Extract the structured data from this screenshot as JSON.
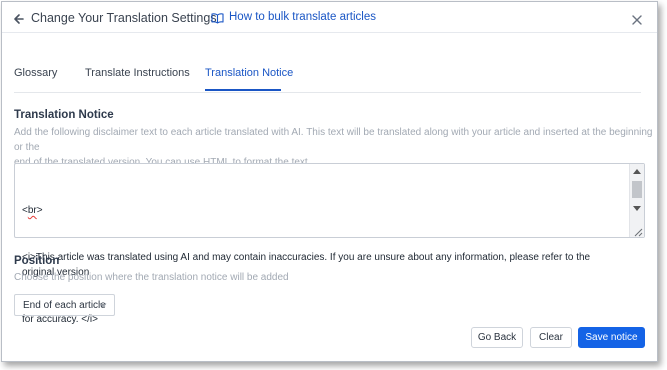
{
  "header": {
    "title": "Change Your Translation Settings",
    "help_link": "How to bulk translate articles"
  },
  "tabs": [
    {
      "label": "Glossary"
    },
    {
      "label": "Translate Instructions"
    },
    {
      "label": "Translation Notice"
    }
  ],
  "notice": {
    "title": "Translation Notice",
    "description_line1": "Add the following disclaimer text to each article translated with AI. This text will be translated along with your article and inserted at the beginning or the",
    "description_line2": "end of the translated version. You can use HTML to format the text.",
    "text_line1_prefix": "<",
    "text_line1_word": "br",
    "text_line1_suffix": ">",
    "text_line2": "<i>This article was translated using AI and may contain inaccuracies. If you are unsure about any information, please refer to the original version",
    "text_line3": "for accuracy. </i>"
  },
  "position": {
    "title": "Position",
    "description": "Choose the position where the translation notice will be added",
    "selected": "End of each article"
  },
  "footer": {
    "go_back": "Go Back",
    "clear": "Clear",
    "save": "Save notice"
  },
  "colors": {
    "accent": "#1a56c5",
    "primary_button": "#1463e6"
  },
  "icons": {
    "back": "arrow-left-icon",
    "help": "book-open-icon",
    "close": "close-icon",
    "select": "chevron-down-icon"
  }
}
